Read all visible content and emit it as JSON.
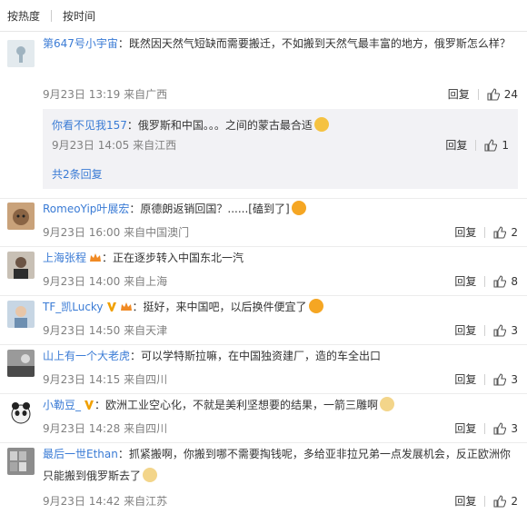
{
  "sort": {
    "hot_label": "按热度",
    "time_label": "按时间"
  },
  "actions": {
    "reply_label": "回复"
  },
  "comments": [
    {
      "user": "第647号小宇宙",
      "text": "：既然因天然气短缺而需要搬迁，不如搬到天然气最丰富的地方，俄罗斯怎么样？",
      "time": "9月23日 13:19 来自广西",
      "likes": "24",
      "subreply": {
        "user": "你看不见我157",
        "text": "：俄罗斯和中国。。。之间的蒙古最合适",
        "time": "9月23日 14:05 来自江西",
        "likes": "1"
      },
      "more_replies": "共2条回复"
    },
    {
      "user": "RomeoYip叶展宏",
      "text": "：原德朗返销回国？......[磕到了]",
      "time": "9月23日 16:00 来自中国澳门",
      "likes": "2"
    },
    {
      "user": "上海张程",
      "text": "：正在逐步转入中国东北一汽",
      "time": "9月23日 14:00 来自上海",
      "likes": "8"
    },
    {
      "user": "TF_凯Lucky",
      "text": "：挺好，来中国吧，以后换件便宜了",
      "time": "9月23日 14:50 来自天津",
      "likes": "3"
    },
    {
      "user": "山上有一个大老虎",
      "text": "：可以学特斯拉嘛，在中国独资建厂，造的车全出口",
      "time": "9月23日 14:15 来自四川",
      "likes": "3"
    },
    {
      "user": "小勒豆_",
      "text": "：欧洲工业空心化，不就是美利坚想要的结果，一箭三雕啊",
      "time": "9月23日 14:28 来自四川",
      "likes": "3"
    },
    {
      "user": "最后一世Ethan",
      "text": "：抓紧搬啊，你搬到哪不需要掏钱呢，多给亚非拉兄弟一点发展机会，反正欧洲你",
      "text2": "只能搬到俄罗斯去了",
      "time": "9月23日 14:42 来自江苏",
      "likes": "2"
    }
  ]
}
